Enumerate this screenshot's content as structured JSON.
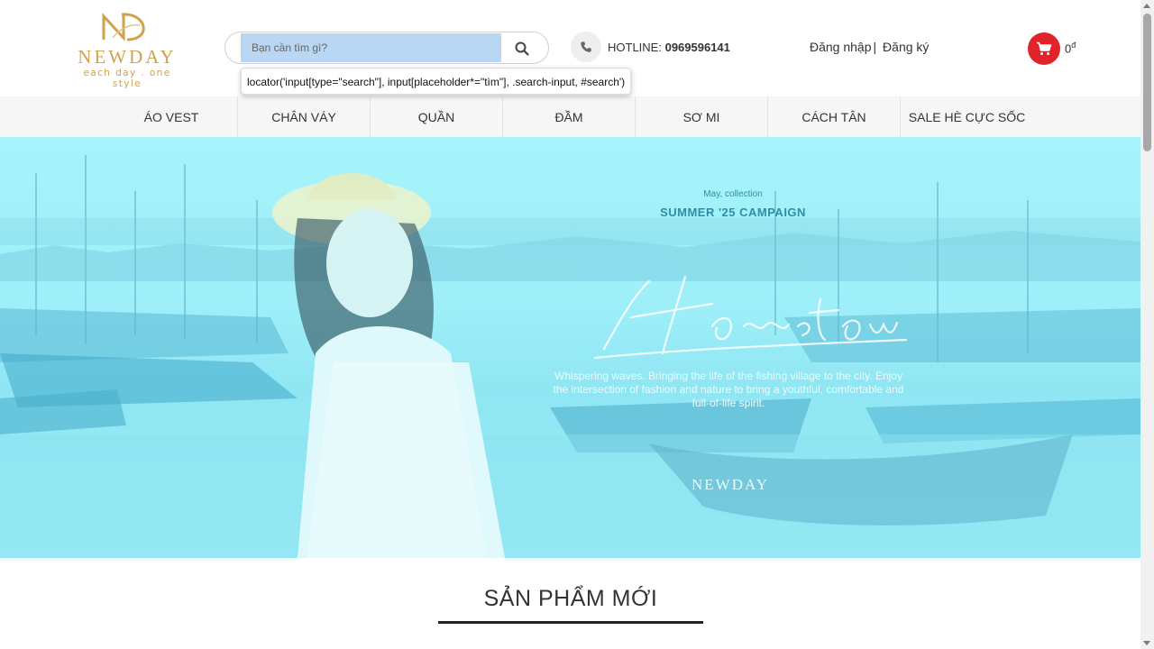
{
  "header": {
    "logo": {
      "brand": "NEWDAY",
      "tagline": "each day . one style",
      "mark_color": "#cfa34a"
    },
    "search": {
      "placeholder": "Bạn cần tìm gì?",
      "value": "",
      "button_icon": "search-icon",
      "highlight_color": "#b9d6f2"
    },
    "tooltip": "locator('input[type=\"search\"], input[placeholder*=\"tìm\"], .search-input, #search')",
    "hotline": {
      "icon": "phone-icon",
      "label": "HOTLINE:",
      "number": "0969596141"
    },
    "auth": {
      "login": "Đăng nhập",
      "separator": "|",
      "register": "Đăng ký"
    },
    "cart": {
      "icon": "cart-icon",
      "total": "0",
      "currency": "đ",
      "color": "#e0242a"
    }
  },
  "nav": {
    "items": [
      {
        "label": "ÁO VEST"
      },
      {
        "label": "CHÂN VÁY"
      },
      {
        "label": "QUẦN"
      },
      {
        "label": "ĐẦM"
      },
      {
        "label": "SƠ MI"
      },
      {
        "label": "CÁCH TÂN"
      },
      {
        "label": "SALE HÈ CỰC SỐC"
      }
    ]
  },
  "banner": {
    "kicker": "May, collection",
    "campaign": "SUMMER '25 CAMPAIGN",
    "script_title": "Hometown",
    "description": "Whispering waves. Bringing the life of the fishing village to the city. Enjoy the intersection of fashion and nature to bring a youthful, comfortable and full-of-life spirit.",
    "brand": "NEWDAY",
    "tint_color": "#a6f3fb"
  },
  "section": {
    "title": "SẢN PHẨM MỚI"
  }
}
